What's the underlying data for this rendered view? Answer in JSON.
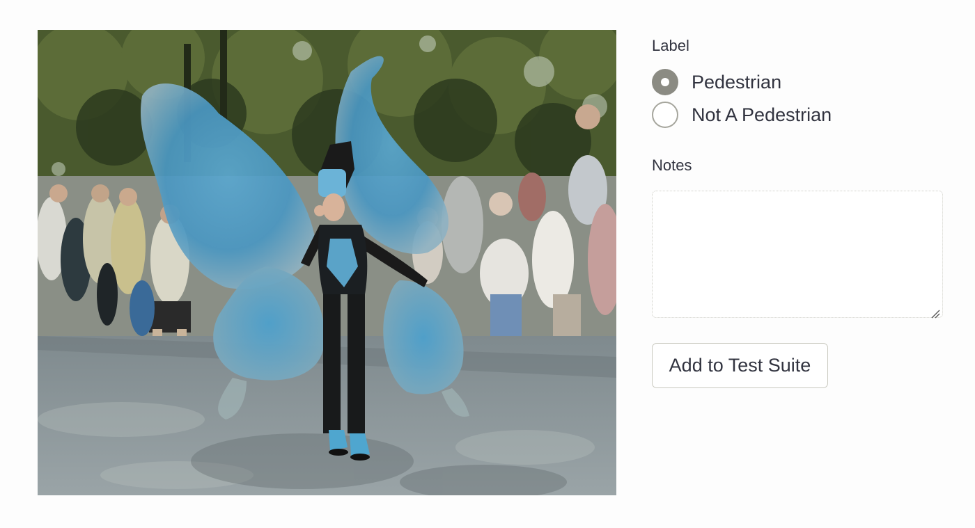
{
  "image": {
    "alt": "Performer in large blue butterfly-wing costume walking in a street parade, crowd of spectators behind, trees in background"
  },
  "label_field": {
    "title": "Label",
    "options": [
      {
        "text": "Pedestrian",
        "checked": true
      },
      {
        "text": "Not A Pedestrian",
        "checked": false
      }
    ]
  },
  "notes_field": {
    "title": "Notes",
    "value": "",
    "placeholder": ""
  },
  "submit": {
    "label": "Add to Test Suite"
  },
  "colors": {
    "radio_selected": "#8b8b83",
    "radio_border": "#a5a59c",
    "text": "#31333f"
  }
}
